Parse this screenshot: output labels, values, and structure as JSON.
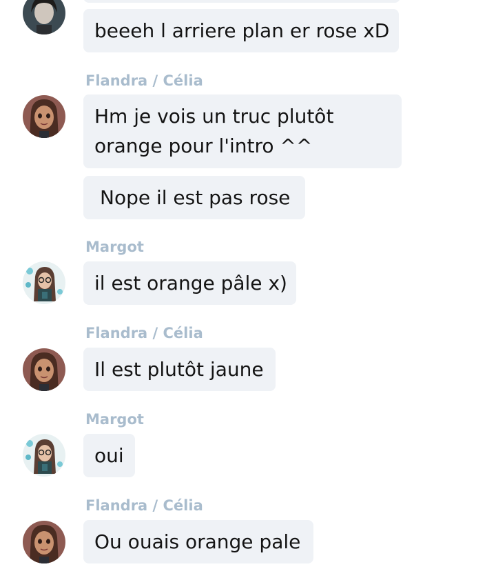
{
  "messages": [
    {
      "text": "beeeh l arriere plan er rose xD"
    },
    {
      "sender": "Flandra / Célia",
      "text_line1": "Hm je vois un truc plutôt",
      "text_line2": "orange pour l'intro ^^"
    },
    {
      "text": "Nope il est pas rose"
    },
    {
      "sender": "Margot",
      "text": "il est orange pâle x)"
    },
    {
      "sender": "Flandra / Célia",
      "text": "Il est plutôt jaune"
    },
    {
      "sender": "Margot",
      "text": "oui"
    },
    {
      "sender": "Flandra / Célia",
      "text": "Ou ouais orange pale"
    }
  ],
  "colors": {
    "sender_name": "#a9bccd",
    "bubble_background": "#eff2f6",
    "message_text": "#141414"
  }
}
